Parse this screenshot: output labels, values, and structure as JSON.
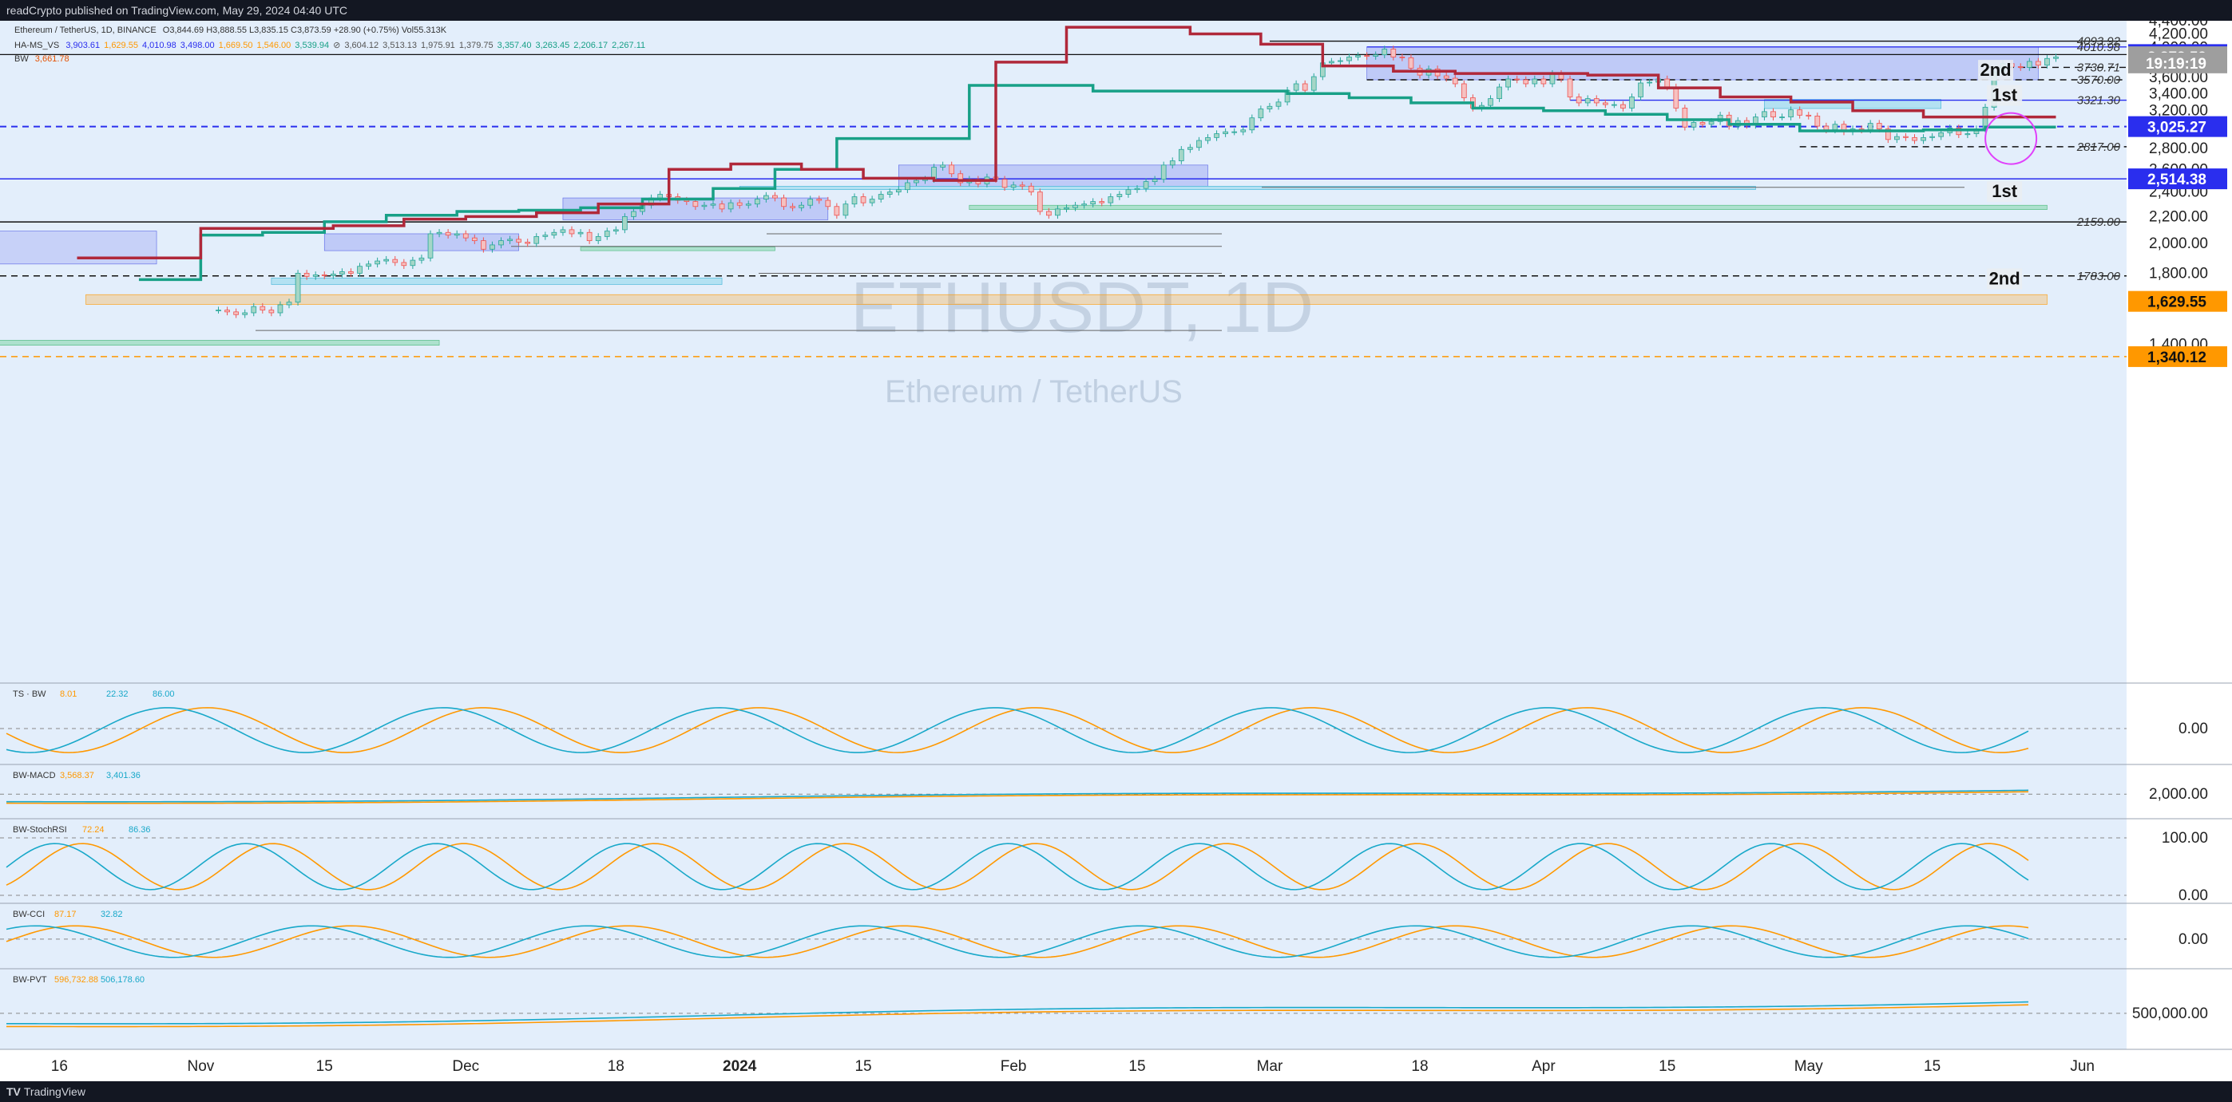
{
  "header": {
    "published": "readCrypto published on TradingView.com, May 29, 2024 04:40 UTC"
  },
  "footer": {
    "brand": "TradingView"
  },
  "legend": {
    "symbol": "Ethereum / TetherUS, 1D, BINANCE",
    "ohlc": "O3,844.69 H3,888.55 L3,835.15 C3,873.59 +28.90 (+0.75%) Vol55.313K",
    "ha_label": "HA-MS_VS",
    "ha_values": [
      "3,903.61",
      "1,629.55",
      "4,010.98",
      "3,498.00",
      "1,669.50",
      "1,546.00",
      "3,539.94",
      "⊘",
      "3,604.12",
      "3,513.13",
      "1,975.91",
      "1,379.75",
      "3,357.40",
      "3,263.45",
      "2,206.17",
      "2,267.11"
    ],
    "bw_label": "BW",
    "bw_value": "3,661.78"
  },
  "watermark": {
    "symbol": "ETHUSDT, 1D",
    "name": "Ethereum / TetherUS"
  },
  "colors": {
    "green": "#26a69a",
    "red": "#ef5350",
    "blue": "#2962ff",
    "teal": "#18a087",
    "maroon": "#b0283a",
    "orange": "#ff9800"
  },
  "chart_data": {
    "type": "candlestick",
    "symbol": "ETHUSDT",
    "interval": "1D",
    "exchange": "BINANCE",
    "y_scale": "log",
    "ylim": [
      1200,
      4400
    ],
    "price_ticks": [
      "4,400.00",
      "4,200.00",
      "4,000.00",
      "3,600.00",
      "3,400.00",
      "3,200.00",
      "2,800.00",
      "2,600.00",
      "2,400.00",
      "2,200.00",
      "2,000.00",
      "1,800.00",
      "1,400.00"
    ],
    "price_tick_values": [
      4400,
      4200,
      4000,
      3600,
      3400,
      3200,
      2800,
      2600,
      2400,
      2200,
      2000,
      1800,
      1400
    ],
    "price_badges": [
      {
        "label": "3,903.61",
        "value": 3903.61,
        "color": "#2a2eee"
      },
      {
        "label": "3,873.59",
        "value": 3873.59,
        "color": "#9e9e9e"
      },
      {
        "label": "19:19:19",
        "value": 3790,
        "color": "#9e9e9e"
      },
      {
        "label": "3,025.27",
        "value": 3025.27,
        "color": "#2a2eee"
      },
      {
        "label": "2,514.38",
        "value": 2514.38,
        "color": "#2a2eee"
      },
      {
        "label": "1,629.55",
        "value": 1629.55,
        "color": "#ff9800"
      },
      {
        "label": "1,340.12",
        "value": 1340.12,
        "color": "#ff9800"
      }
    ],
    "level_labels": [
      {
        "label": "4093.92",
        "value": 4093.92,
        "style": "solid",
        "color": "#111"
      },
      {
        "label": "4010.98",
        "value": 4010.98,
        "style": "solid",
        "color": "#2a2eee"
      },
      {
        "label": "3730.71",
        "value": 3730.71,
        "style": "dash",
        "color": "#111"
      },
      {
        "label": "3570.00",
        "value": 3570,
        "style": "dash",
        "color": "#111"
      },
      {
        "label": "3321.30",
        "value": 3321.3,
        "style": "solid",
        "color": "#2a2eee"
      },
      {
        "label": "2817.00",
        "value": 2817,
        "style": "dash",
        "color": "#111"
      },
      {
        "label": "2159.00",
        "value": 2159,
        "style": "solid",
        "color": "#111"
      },
      {
        "label": "1783.00",
        "value": 1783,
        "style": "dash",
        "color": "#111"
      }
    ],
    "text_annotations": [
      {
        "text": "2nd",
        "price": 3640,
        "date": "2024-05-22"
      },
      {
        "text": "1st",
        "price": 3330,
        "date": "2024-05-23"
      },
      {
        "text": "1st",
        "price": 2370,
        "date": "2024-05-23"
      },
      {
        "text": "2nd",
        "price": 1740,
        "date": "2024-05-23"
      }
    ],
    "x_ticks": [
      {
        "label": "16",
        "date": "2023-10-16"
      },
      {
        "label": "Nov",
        "date": "2023-11-01"
      },
      {
        "label": "15",
        "date": "2023-11-15"
      },
      {
        "label": "Dec",
        "date": "2023-12-01"
      },
      {
        "label": "18",
        "date": "2023-12-18"
      },
      {
        "label": "2024",
        "date": "2024-01-01"
      },
      {
        "label": "15",
        "date": "2024-01-15"
      },
      {
        "label": "Feb",
        "date": "2024-02-01"
      },
      {
        "label": "15",
        "date": "2024-02-15"
      },
      {
        "label": "Mar",
        "date": "2024-03-01"
      },
      {
        "label": "18",
        "date": "2024-03-18"
      },
      {
        "label": "Apr",
        "date": "2024-04-01"
      },
      {
        "label": "15",
        "date": "2024-04-15"
      },
      {
        "label": "May",
        "date": "2024-05-01"
      },
      {
        "label": "15",
        "date": "2024-05-15"
      },
      {
        "label": "Jun",
        "date": "2024-06-01"
      }
    ],
    "date_range": [
      "2023-10-10",
      "2024-06-06"
    ],
    "last_date": "2024-05-29",
    "closes": [
      1580,
      1570,
      1555,
      1565,
      1600,
      1580,
      1565,
      1610,
      1625,
      1800,
      1780,
      1790,
      1785,
      1795,
      1810,
      1800,
      1845,
      1860,
      1880,
      1890,
      1870,
      1850,
      1885,
      1900,
      2070,
      2080,
      2060,
      2070,
      2040,
      2020,
      1960,
      1990,
      2020,
      2030,
      2010,
      2000,
      2050,
      2060,
      2080,
      2100,
      2070,
      2080,
      2020,
      2050,
      2090,
      2100,
      2200,
      2240,
      2290,
      2350,
      2380,
      2360,
      2330,
      2320,
      2280,
      2290,
      2300,
      2260,
      2310,
      2290,
      2300,
      2340,
      2370,
      2350,
      2280,
      2270,
      2290,
      2340,
      2330,
      2280,
      2210,
      2300,
      2360,
      2310,
      2340,
      2380,
      2400,
      2420,
      2480,
      2500,
      2510,
      2620,
      2640,
      2560,
      2480,
      2510,
      2470,
      2530,
      2510,
      2440,
      2460,
      2450,
      2400,
      2240,
      2210,
      2260,
      2270,
      2290,
      2300,
      2320,
      2310,
      2360,
      2380,
      2420,
      2430,
      2490,
      2510,
      2640,
      2680,
      2790,
      2810,
      2880,
      2910,
      2950,
      2970,
      2970,
      2990,
      3120,
      3220,
      3250,
      3300,
      3440,
      3520,
      3440,
      3610,
      3790,
      3810,
      3820,
      3870,
      3890,
      3880,
      3900,
      3980,
      3870,
      3860,
      3720,
      3630,
      3710,
      3620,
      3590,
      3520,
      3350,
      3230,
      3260,
      3340,
      3480,
      3580,
      3570,
      3520,
      3580,
      3520,
      3650,
      3580,
      3360,
      3290,
      3340,
      3290,
      3270,
      3270,
      3230,
      3360,
      3530,
      3540,
      3580,
      3480,
      3230,
      3020,
      3070,
      3050,
      3080,
      3150,
      3030,
      3090,
      3040,
      3130,
      3190,
      3130,
      3130,
      3210,
      3150,
      3140,
      3030,
      2990,
      3050,
      2970,
      3000,
      2990,
      3060,
      3000,
      2890,
      2920,
      2910,
      2880,
      2910,
      2920,
      2960,
      3010,
      2940,
      2950,
      3000,
      3240,
      3670,
      3780,
      3740,
      3730,
      3810,
      3760,
      3850,
      3870
    ],
    "tenkan_line_values": [
      1760,
      2060,
      2080,
      2160,
      2210,
      2240,
      2250,
      2270,
      2340,
      2430,
      2600,
      2900,
      2900,
      3500,
      3500,
      3430,
      3430,
      3430,
      3400,
      3350,
      3290,
      3230,
      3200,
      3160,
      3100,
      3050,
      2980,
      2980,
      2990,
      3020
    ],
    "red_line_values": [
      1900,
      1900,
      2110,
      2110,
      2130,
      2180,
      2200,
      2230,
      2300,
      2600,
      2650,
      2600,
      2520,
      2500,
      3800,
      4300,
      4300,
      4200,
      4050,
      3750,
      3680,
      3650,
      3650,
      3630,
      3470,
      3360,
      3300,
      3200,
      3130,
      3130
    ],
    "indicators": [
      {
        "title": "TS · BW",
        "values": [
          "8.01",
          "22.32",
          "86.00"
        ],
        "zero_label": "0.00"
      },
      {
        "title": "BW-MACD",
        "values": [
          "3,568.37",
          "3,401.36"
        ],
        "ref_label": "2,000.00"
      },
      {
        "title": "BW-StochRSI",
        "values": [
          "72.24",
          "86.36"
        ],
        "ref_labels": [
          "100.00",
          "0.00"
        ]
      },
      {
        "title": "BW-CCI",
        "values": [
          "87.17",
          "32.82"
        ],
        "zero_label": "0.00"
      },
      {
        "title": "BW-PVT",
        "values": [
          "596,732.88",
          "506,178.60"
        ],
        "ref_label": "500,000.00"
      }
    ]
  }
}
